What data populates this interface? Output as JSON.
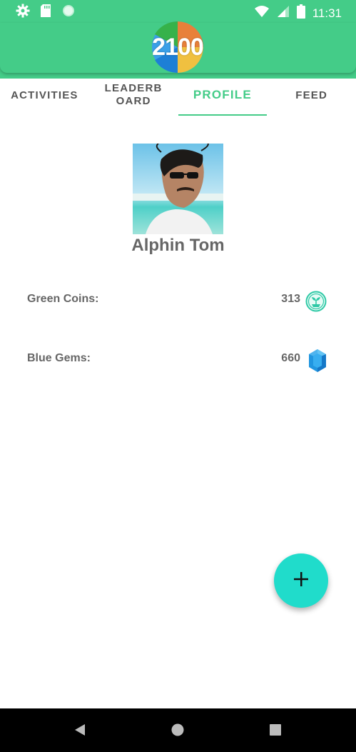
{
  "status_bar": {
    "time": "11:31",
    "icons": [
      "settings-icon",
      "sd-card-icon",
      "circle-icon",
      "wifi-icon",
      "signal-icon",
      "battery-icon"
    ]
  },
  "app": {
    "logo_text": "2100",
    "accent_color": "#44cc88"
  },
  "tabs": [
    {
      "label": "ACTIVITIES",
      "active": false
    },
    {
      "label": "LEADERBOARD",
      "active": false
    },
    {
      "label": "PROFILE",
      "active": true
    },
    {
      "label": "FEED",
      "active": false
    }
  ],
  "profile": {
    "name": "Alphin Tom",
    "stats": [
      {
        "label": "Green Coins:",
        "value": "313",
        "icon": "green-coin-icon"
      },
      {
        "label": "Blue Gems:",
        "value": "660",
        "icon": "blue-gem-icon"
      }
    ]
  },
  "fab": {
    "icon": "plus-icon",
    "color": "#20dccb"
  },
  "nav_bar": {
    "buttons": [
      "back-icon",
      "home-icon",
      "recents-icon"
    ]
  }
}
